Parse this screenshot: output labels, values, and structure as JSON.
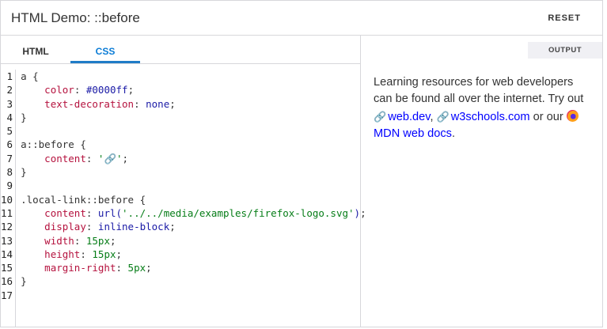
{
  "header": {
    "title": "HTML Demo: ::before",
    "reset_label": "RESET"
  },
  "tabs": [
    {
      "label": "HTML"
    },
    {
      "label": "CSS"
    }
  ],
  "code_lines": [
    [
      {
        "t": "sel",
        "v": "a "
      },
      {
        "t": "punc",
        "v": "{"
      }
    ],
    [
      {
        "t": "",
        "v": "    "
      },
      {
        "t": "prop",
        "v": "color"
      },
      {
        "t": "punc",
        "v": ": "
      },
      {
        "t": "val",
        "v": "#0000ff"
      },
      {
        "t": "punc",
        "v": ";"
      }
    ],
    [
      {
        "t": "",
        "v": "    "
      },
      {
        "t": "prop",
        "v": "text-decoration"
      },
      {
        "t": "punc",
        "v": ": "
      },
      {
        "t": "val",
        "v": "none"
      },
      {
        "t": "punc",
        "v": ";"
      }
    ],
    [
      {
        "t": "punc",
        "v": "}"
      }
    ],
    [],
    [
      {
        "t": "sel",
        "v": "a::before "
      },
      {
        "t": "punc",
        "v": "{"
      }
    ],
    [
      {
        "t": "",
        "v": "    "
      },
      {
        "t": "prop",
        "v": "content"
      },
      {
        "t": "punc",
        "v": ": "
      },
      {
        "t": "str",
        "v": "'🔗'"
      },
      {
        "t": "punc",
        "v": ";"
      }
    ],
    [
      {
        "t": "punc",
        "v": "}"
      }
    ],
    [],
    [
      {
        "t": "sel",
        "v": ".local-link::before "
      },
      {
        "t": "punc",
        "v": "{"
      }
    ],
    [
      {
        "t": "",
        "v": "    "
      },
      {
        "t": "prop",
        "v": "content"
      },
      {
        "t": "punc",
        "v": ": "
      },
      {
        "t": "val",
        "v": "url("
      },
      {
        "t": "str",
        "v": "'../../media/examples/firefox-logo.svg'"
      },
      {
        "t": "val",
        "v": ")"
      },
      {
        "t": "punc",
        "v": ";"
      }
    ],
    [
      {
        "t": "",
        "v": "    "
      },
      {
        "t": "prop",
        "v": "display"
      },
      {
        "t": "punc",
        "v": ": "
      },
      {
        "t": "val",
        "v": "inline-block"
      },
      {
        "t": "punc",
        "v": ";"
      }
    ],
    [
      {
        "t": "",
        "v": "    "
      },
      {
        "t": "prop",
        "v": "width"
      },
      {
        "t": "punc",
        "v": ": "
      },
      {
        "t": "str",
        "v": "15px"
      },
      {
        "t": "punc",
        "v": ";"
      }
    ],
    [
      {
        "t": "",
        "v": "    "
      },
      {
        "t": "prop",
        "v": "height"
      },
      {
        "t": "punc",
        "v": ": "
      },
      {
        "t": "str",
        "v": "15px"
      },
      {
        "t": "punc",
        "v": ";"
      }
    ],
    [
      {
        "t": "",
        "v": "    "
      },
      {
        "t": "prop",
        "v": "margin-right"
      },
      {
        "t": "punc",
        "v": ": "
      },
      {
        "t": "str",
        "v": "5px"
      },
      {
        "t": "punc",
        "v": ";"
      }
    ],
    [
      {
        "t": "punc",
        "v": "}"
      }
    ],
    []
  ],
  "output": {
    "label": "OUTPUT",
    "intro": "Learning resources for web developers can be found all over the internet. Try out ",
    "link1": "web.dev",
    "sep1": ", ",
    "link2": "w3schools.com",
    "sep2": " or our ",
    "link3": "MDN web docs",
    "end": "."
  }
}
